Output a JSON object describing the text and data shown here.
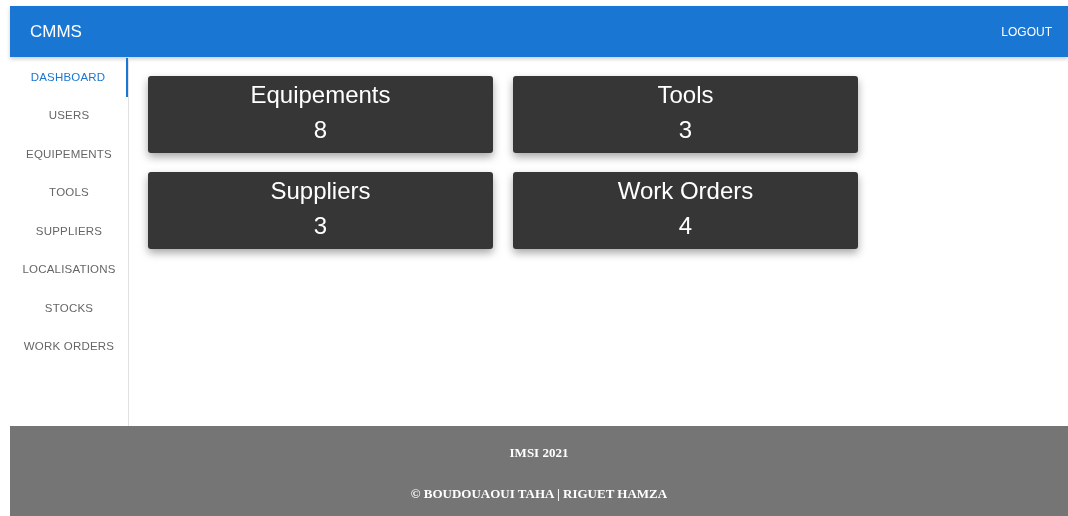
{
  "app_bar": {
    "title": "CMMS",
    "logout": "LOGOUT"
  },
  "sidebar": {
    "items": [
      {
        "label": "DASHBOARD",
        "selected": true
      },
      {
        "label": "USERS",
        "selected": false
      },
      {
        "label": "EQUIPEMENTS",
        "selected": false
      },
      {
        "label": "TOOLS",
        "selected": false
      },
      {
        "label": "SUPPLIERS",
        "selected": false
      },
      {
        "label": "LOCALISATIONS",
        "selected": false
      },
      {
        "label": "STOCKS",
        "selected": false
      },
      {
        "label": "WORK ORDERS",
        "selected": false
      }
    ]
  },
  "cards": [
    {
      "title": "Equipements",
      "count": "8"
    },
    {
      "title": "Tools",
      "count": "3"
    },
    {
      "title": "Suppliers",
      "count": "3"
    },
    {
      "title": "Work Orders",
      "count": "4"
    }
  ],
  "footer": {
    "lines": [
      "IMSI 2021",
      "© BOUDOUAOUI TAHA | RIGUET HAMZA"
    ]
  }
}
